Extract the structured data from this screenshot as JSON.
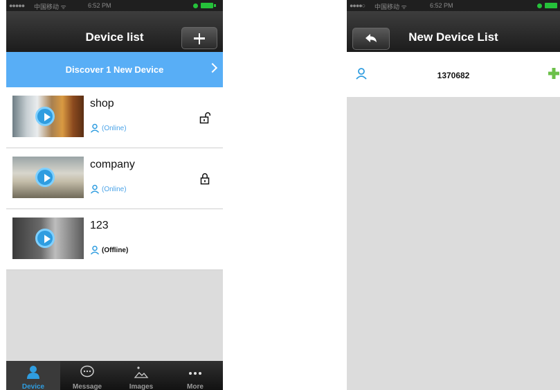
{
  "left": {
    "status": {
      "signal": "●●●●●",
      "carrier": "中国移动 ᯤ",
      "time": "6:52 PM"
    },
    "title": "Device list",
    "banner": "Discover 1 New Device",
    "devices": [
      {
        "name": "shop",
        "status": "(Online)",
        "lock": "unlocked"
      },
      {
        "name": "company",
        "status": "(Online)",
        "lock": "locked"
      },
      {
        "name": "123",
        "status": "(Offline)",
        "lock": "none"
      }
    ],
    "tabs": [
      {
        "label": "Device",
        "icon": "person-icon",
        "active": true
      },
      {
        "label": "Message",
        "icon": "chat-bubble-icon",
        "active": false
      },
      {
        "label": "Images",
        "icon": "image-icon",
        "active": false
      },
      {
        "label": "More",
        "icon": "more-dots-icon",
        "active": false
      }
    ]
  },
  "right": {
    "status": {
      "signal": "●●●●○",
      "carrier": "中国移动 ᯤ",
      "time": "6:52 PM"
    },
    "title": "New Device List",
    "new_devices": [
      {
        "id": "1370682"
      }
    ]
  },
  "colors": {
    "accent": "#58aef6",
    "icon_blue": "#2f9de0",
    "online": "#4aa3e8",
    "add_green": "#6cc04a",
    "navbar": "#2a2a2a",
    "background": "#dcdcdc"
  }
}
